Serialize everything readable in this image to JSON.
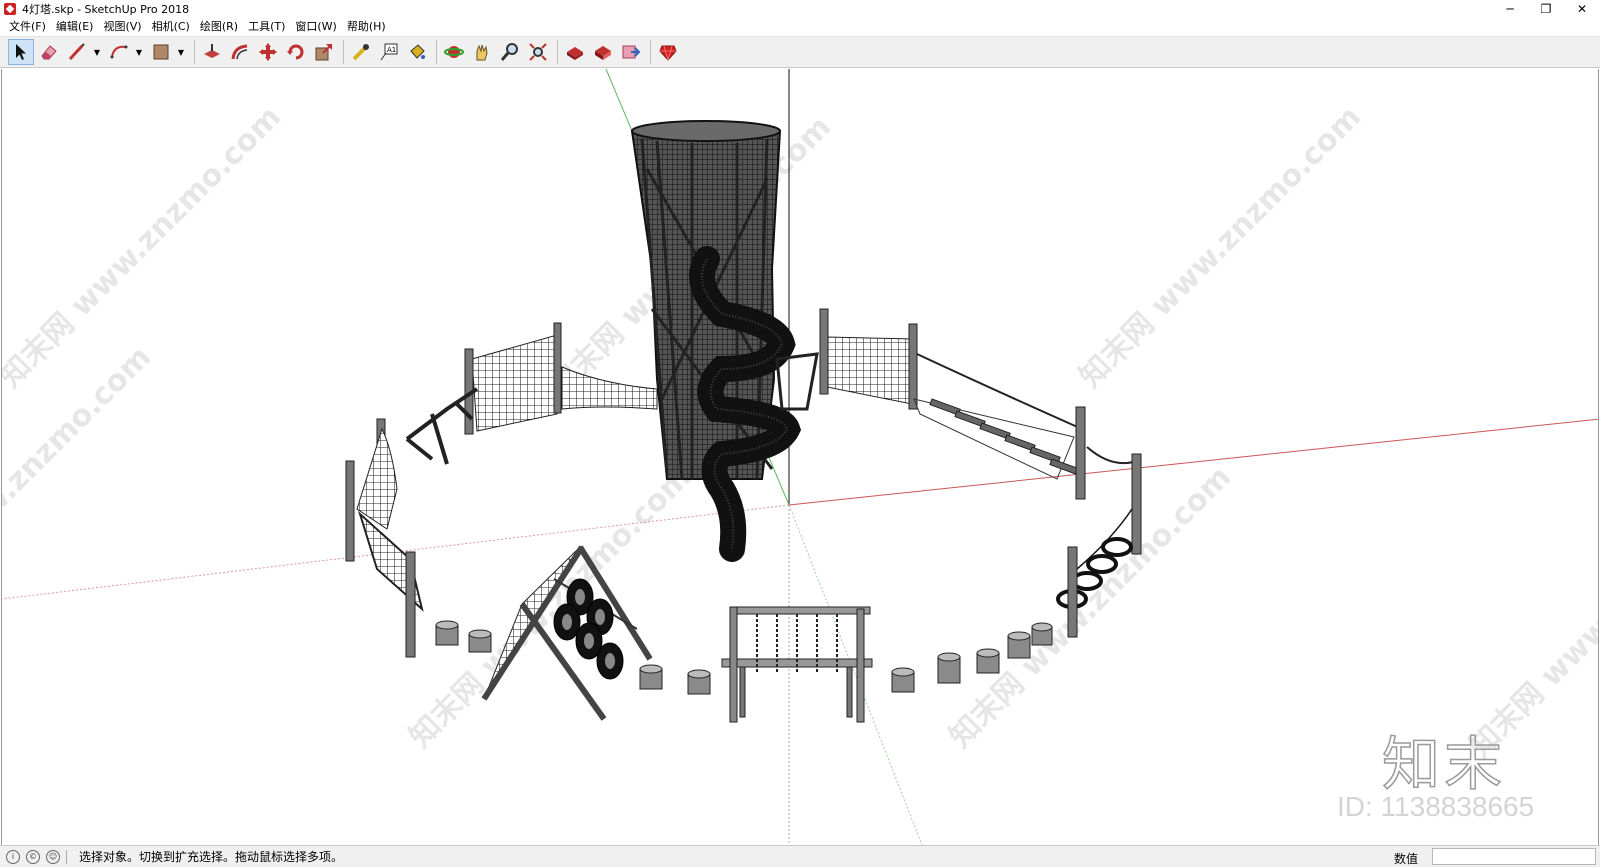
{
  "window": {
    "title": "4灯塔.skp - SketchUp Pro 2018",
    "minimize": "─",
    "restore": "❐",
    "close": "✕"
  },
  "menu": [
    "文件(F)",
    "编辑(E)",
    "视图(V)",
    "相机(C)",
    "绘图(R)",
    "工具(T)",
    "窗口(W)",
    "帮助(H)"
  ],
  "toolbar": {
    "icons": [
      "select-icon",
      "eraser-icon",
      "line-icon",
      "arc-icon",
      "rectangle-icon",
      "push-pull-icon",
      "offset-icon",
      "move-icon",
      "rotate-icon",
      "scale-icon",
      "tape-measure-icon",
      "text-icon",
      "paint-bucket-icon",
      "orbit-icon",
      "pan-icon",
      "zoom-icon",
      "zoom-extents-icon",
      "warehouse-icon",
      "extension-icon",
      "share-icon",
      "ruby-icon"
    ]
  },
  "watermark": {
    "logo": "知末",
    "id": "ID: 1138838665",
    "text": "知末网 www.znzmo.com"
  },
  "status": {
    "message": "选择对象。切换到扩充选择。拖动鼠标选择多项。",
    "measure_label": "数值",
    "measure_value": ""
  },
  "colors": {
    "axis_red": "#cc4444",
    "axis_green": "#44aa44",
    "model": "#3a3a3a",
    "toolbar_bg": "#f0f0f0"
  }
}
